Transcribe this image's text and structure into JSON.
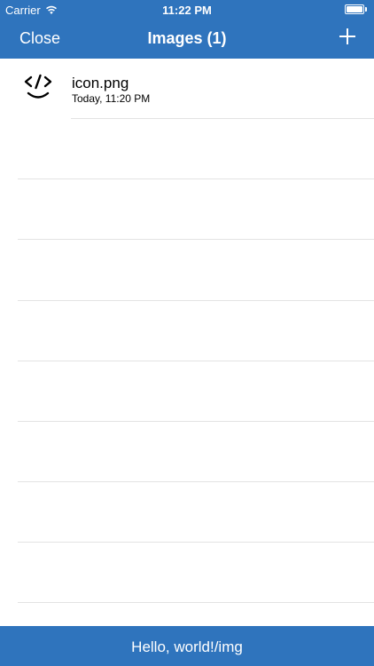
{
  "status_bar": {
    "carrier": "Carrier",
    "time": "11:22 PM",
    "wifi_icon": "wifi-icon",
    "battery_icon": "battery-icon"
  },
  "nav": {
    "close_label": "Close",
    "title": "Images (1)",
    "add_icon": "plus-icon"
  },
  "list": {
    "items": [
      {
        "filename": "icon.png",
        "date": "Today, 11:20 PM",
        "icon": "code-smile-icon"
      }
    ]
  },
  "bottom_bar": {
    "label": "Hello, world!/img"
  },
  "colors": {
    "bar": "#2F74BD",
    "separator": "#e3e3e3",
    "text_on_bar": "#ffffff"
  }
}
